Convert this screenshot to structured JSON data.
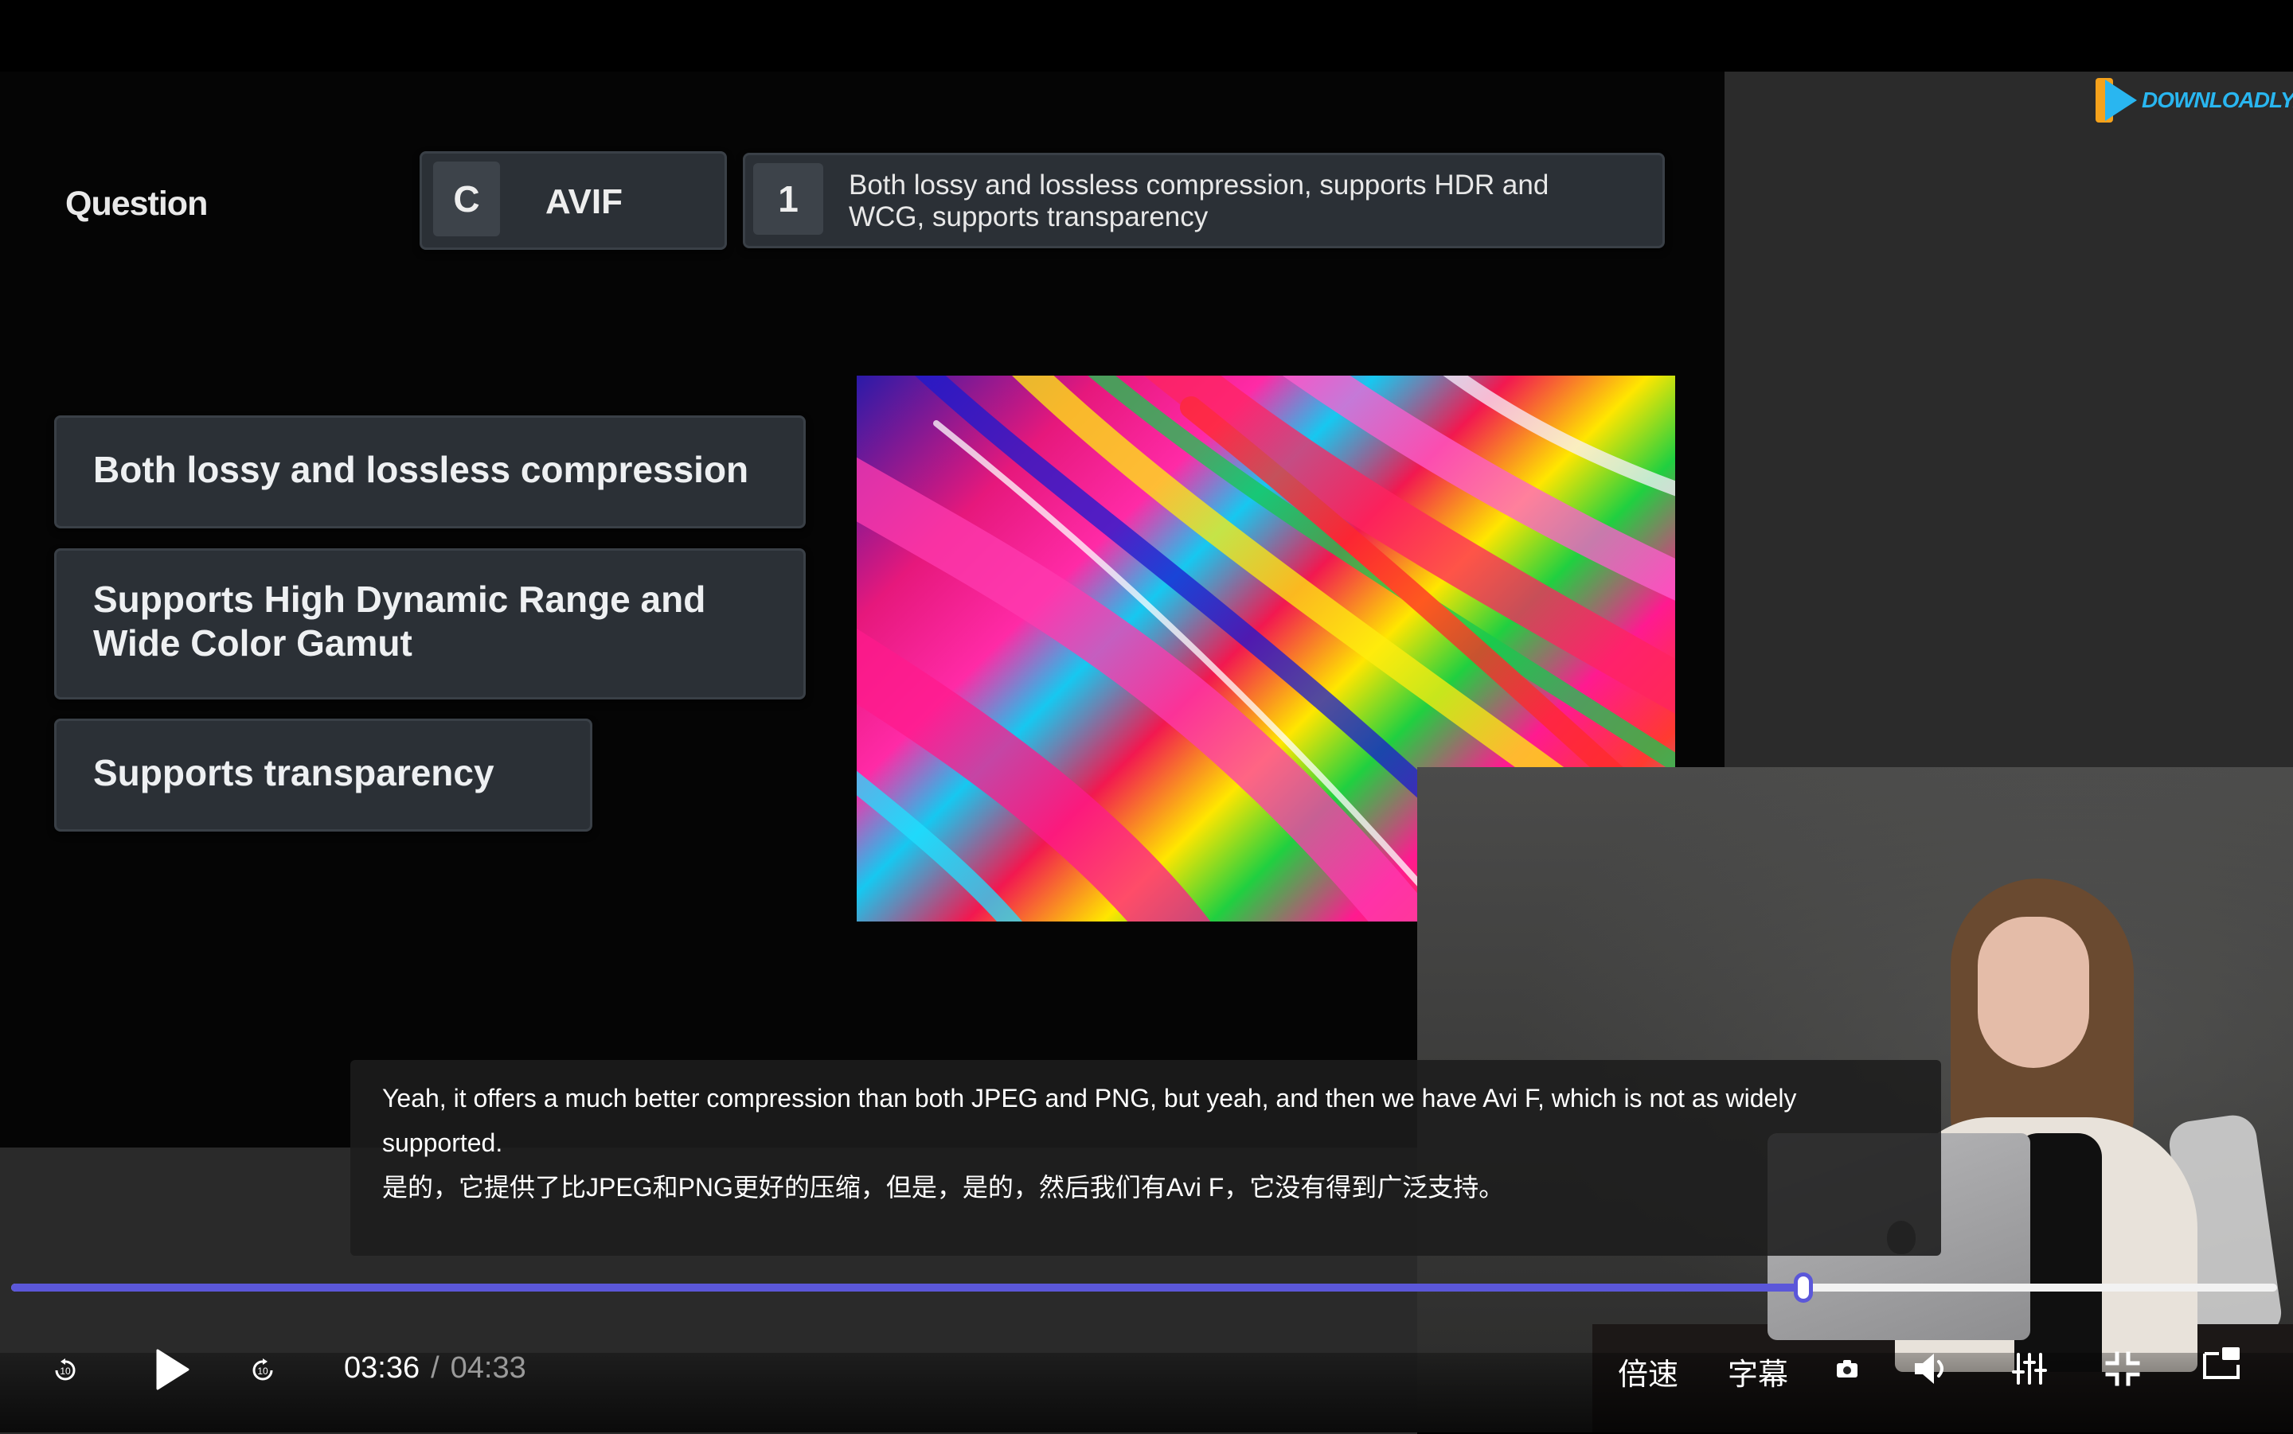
{
  "slide": {
    "question_label": "Question",
    "answer_key": "C",
    "answer_format": "AVIF",
    "match_key": "1",
    "match_text_line1": "Both lossy and lossless compression, supports HDR and",
    "match_text_line2": "WCG, supports transparency",
    "features": [
      {
        "line1": "Both lossy and lossless compression",
        "line2": ""
      },
      {
        "line1": "Supports High Dynamic Range and",
        "line2": "Wide Color Gamut"
      },
      {
        "line1": "Supports transparency",
        "line2": ""
      }
    ]
  },
  "watermark": {
    "text": "DOWNLOADLY.IR"
  },
  "subtitles": {
    "en_line1": "Yeah, it offers a much better compression than both JPEG and PNG, but yeah, and then we have Avi F, which is not as widely",
    "en_line2": "supported.",
    "zh": "是的，它提供了比JPEG和PNG更好的压缩，但是，是的，然后我们有Avi F，它没有得到广泛支持。"
  },
  "player": {
    "current_time": "03:36",
    "separator": "/",
    "duration": "04:33",
    "progress_fraction": 0.791,
    "speed_label": "倍速",
    "subtitle_label": "字幕",
    "accent_color": "#5b57d9",
    "icons": [
      "rewind-icon",
      "play-icon",
      "forward-icon",
      "camera-icon",
      "volume-icon",
      "equalizer-icon",
      "exit-fullscreen-icon",
      "picture-in-picture-icon"
    ]
  }
}
